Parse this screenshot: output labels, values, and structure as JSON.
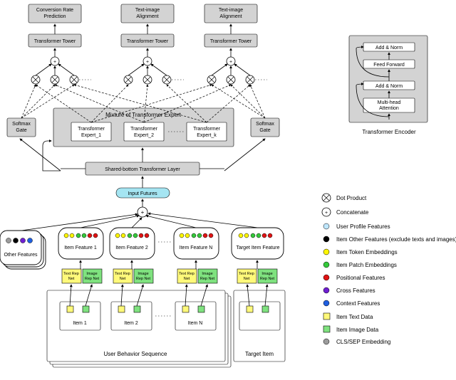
{
  "top": {
    "out1": "Conversion Rate Prediction",
    "out2": "Text-image Alignment",
    "out3": "Text-image Alignment",
    "tower": "Transformer Tower"
  },
  "moe": {
    "title": "Mixture of Transformer Expert",
    "e1": "Transformer Expert_1",
    "e2": "Transformer Expert_2",
    "ek": "Transformer Expert_k",
    "gate": "Softmax Gate"
  },
  "shared": "Shared-bottom Transformer Layer",
  "input": "Input Futures",
  "feat": {
    "other": "Other Features",
    "f1": "Item Feature 1",
    "f2": "Item Feature 2",
    "fn": "Item Feature N",
    "ft": "Target Item Feature",
    "textnet": "Text Rep Net",
    "imgnet": "Image Rep Net"
  },
  "items": {
    "i1": "Item 1",
    "i2": "Item 2",
    "in": "Item N",
    "seq": "User Behavior Sequence",
    "tgt": "Target Item"
  },
  "encoder": {
    "title": "Transformer Encoder",
    "an1": "Add & Norm",
    "ff": "Feed Forward",
    "an2": "Add & Norm",
    "mha": "Multi-head Attention"
  },
  "legend": {
    "dot": "Dot Product",
    "concat": "Concatenate",
    "upf": "User Profile Features",
    "iof": "Item Other Features (exclude texts and images)",
    "ite": "Item Token Embeddings",
    "ipe": "Item Patch Embeddings",
    "pf": "Positional Features",
    "cf": "Cross Features",
    "ctx": "Context Features",
    "itd": "Item Text Data",
    "iid": "Item Image Data",
    "cls": "CLS/SEP Embedding"
  }
}
